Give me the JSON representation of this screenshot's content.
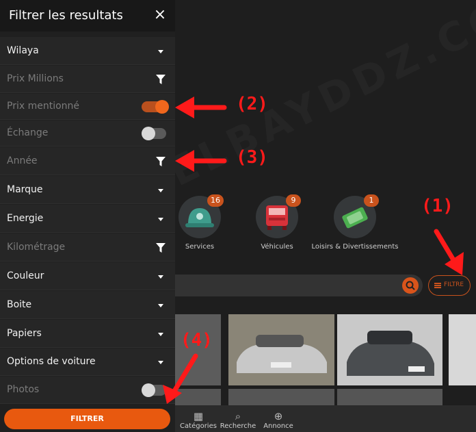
{
  "drawer": {
    "title": "Filtrer les resultats",
    "close_icon": "×",
    "rows": [
      {
        "label": "Wilaya",
        "control": "dropdown",
        "active": true
      },
      {
        "label": "Prix Millions",
        "control": "funnel",
        "active": false
      },
      {
        "label": "Prix mentionné",
        "control": "toggle",
        "active": false,
        "toggle_on": true
      },
      {
        "label": "Échange",
        "control": "toggle",
        "active": false,
        "toggle_on": false
      },
      {
        "label": "Année",
        "control": "funnel",
        "active": false
      },
      {
        "label": "Marque",
        "control": "dropdown",
        "active": true
      },
      {
        "label": "Energie",
        "control": "dropdown",
        "active": true
      },
      {
        "label": "Kilométrage",
        "control": "funnel",
        "active": false
      },
      {
        "label": "Couleur",
        "control": "dropdown",
        "active": true
      },
      {
        "label": "Boite",
        "control": "dropdown",
        "active": true
      },
      {
        "label": "Papiers",
        "control": "dropdown",
        "active": true
      },
      {
        "label": "Options de voiture",
        "control": "dropdown",
        "active": true
      },
      {
        "label": "Photos",
        "control": "toggle",
        "active": false,
        "toggle_on": false
      }
    ],
    "filter_button": "FILTRER"
  },
  "categories": [
    {
      "label": "Services",
      "count": "16",
      "icon": "helmet-icon",
      "color": "#3f9c8c"
    },
    {
      "label": "Véhicules",
      "count": "9",
      "icon": "truck-icon",
      "color": "#d8323a"
    },
    {
      "label": "Loisirs & Divertissements",
      "count": "1",
      "icon": "tickets-icon",
      "color": "#4caf50"
    }
  ],
  "search": {
    "filter_label": "FILTRE"
  },
  "bottom_nav": [
    {
      "label": "Catégories",
      "icon": "grid-icon"
    },
    {
      "label": "Recherche",
      "icon": "search-icon"
    },
    {
      "label": "Annonce",
      "icon": "plus-circle-icon"
    }
  ],
  "annotations": [
    "(1)",
    "(2)",
    "(3)",
    "(4)"
  ],
  "watermark": "WWW.ELBAYDDZ.COM",
  "colors": {
    "accent": "#e8590f",
    "annotation": "#ff1a1a"
  }
}
